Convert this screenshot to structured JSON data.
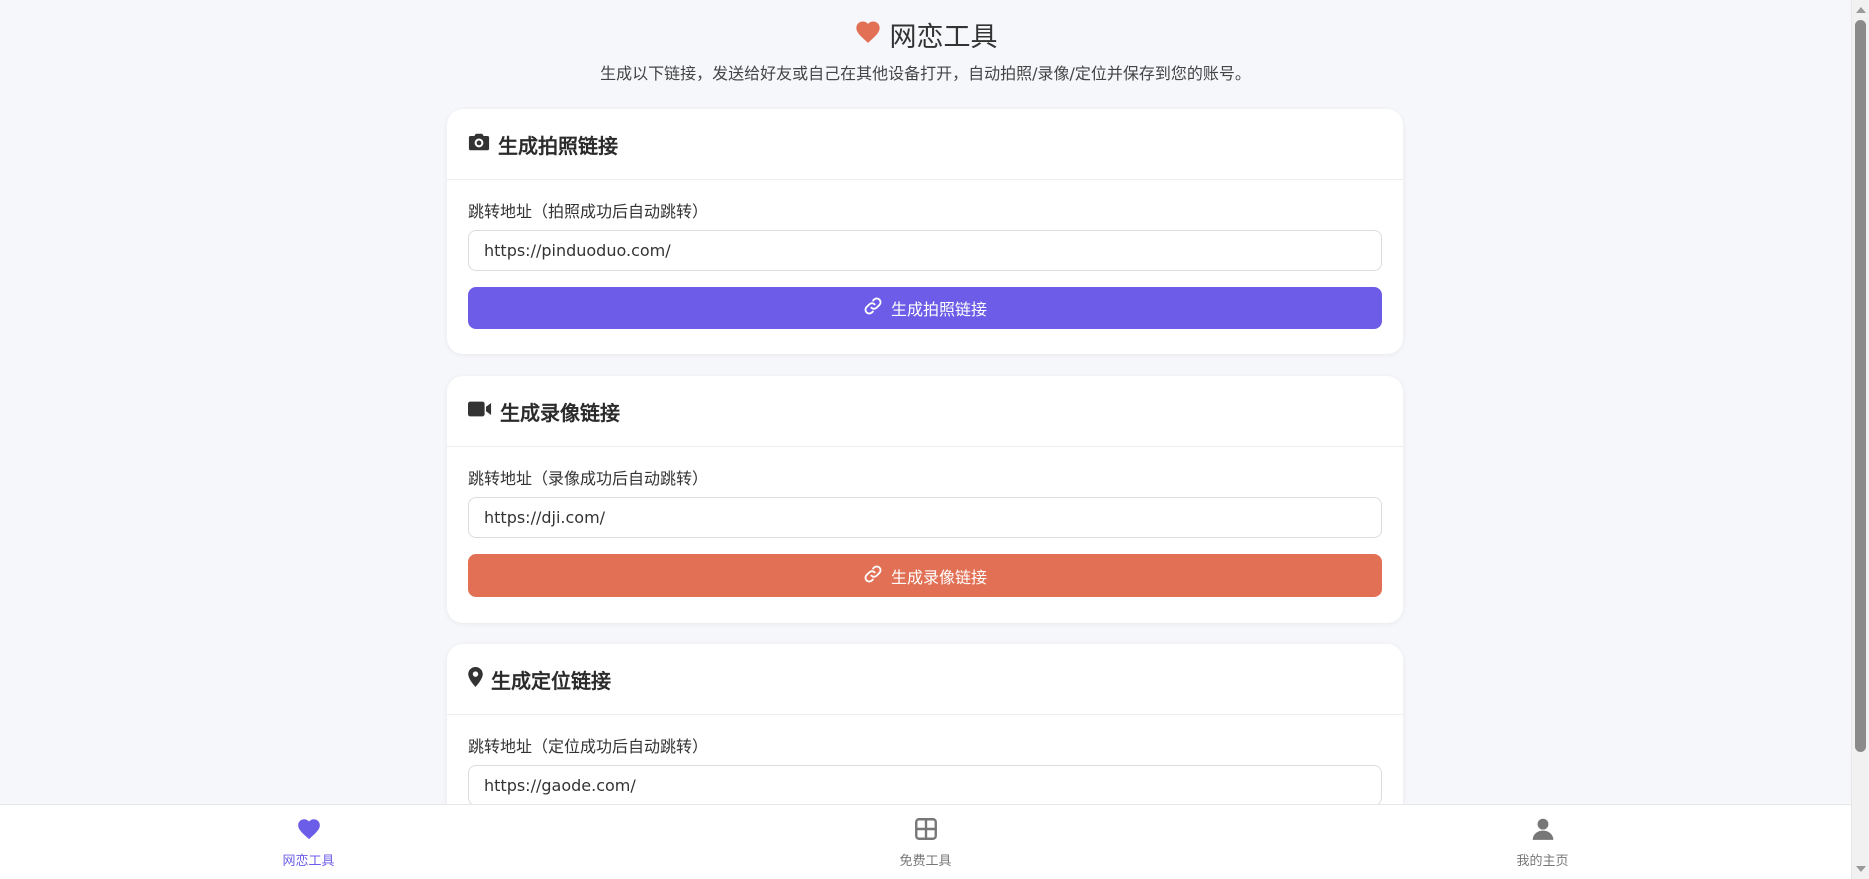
{
  "header": {
    "title": "网恋工具",
    "subtitle": "生成以下链接，发送给好友或自己在其他设备打开，自动拍照/录像/定位并保存到您的账号。"
  },
  "colors": {
    "accent_purple": "#6c5ce7",
    "accent_coral": "#e17055",
    "heart": "#e17055",
    "background": "#f6f7fb"
  },
  "cards": [
    {
      "icon": "camera-icon",
      "title": "生成拍照链接",
      "label": "跳转地址（拍照成功后自动跳转）",
      "input_value": "https://pinduoduo.com/",
      "button_label": "生成拍照链接",
      "button_color": "#6c5ce7"
    },
    {
      "icon": "video-camera-icon",
      "title": "生成录像链接",
      "label": "跳转地址（录像成功后自动跳转）",
      "input_value": "https://dji.com/",
      "button_label": "生成录像链接",
      "button_color": "#e17055"
    },
    {
      "icon": "map-pin-icon",
      "title": "生成定位链接",
      "label": "跳转地址（定位成功后自动跳转）",
      "input_value": "https://gaode.com/"
    }
  ],
  "bottom_nav": [
    {
      "label": "网恋工具",
      "icon": "heart-icon",
      "active": true
    },
    {
      "label": "免费工具",
      "icon": "grid-icon",
      "active": false
    },
    {
      "label": "我的主页",
      "icon": "user-icon",
      "active": false
    }
  ]
}
